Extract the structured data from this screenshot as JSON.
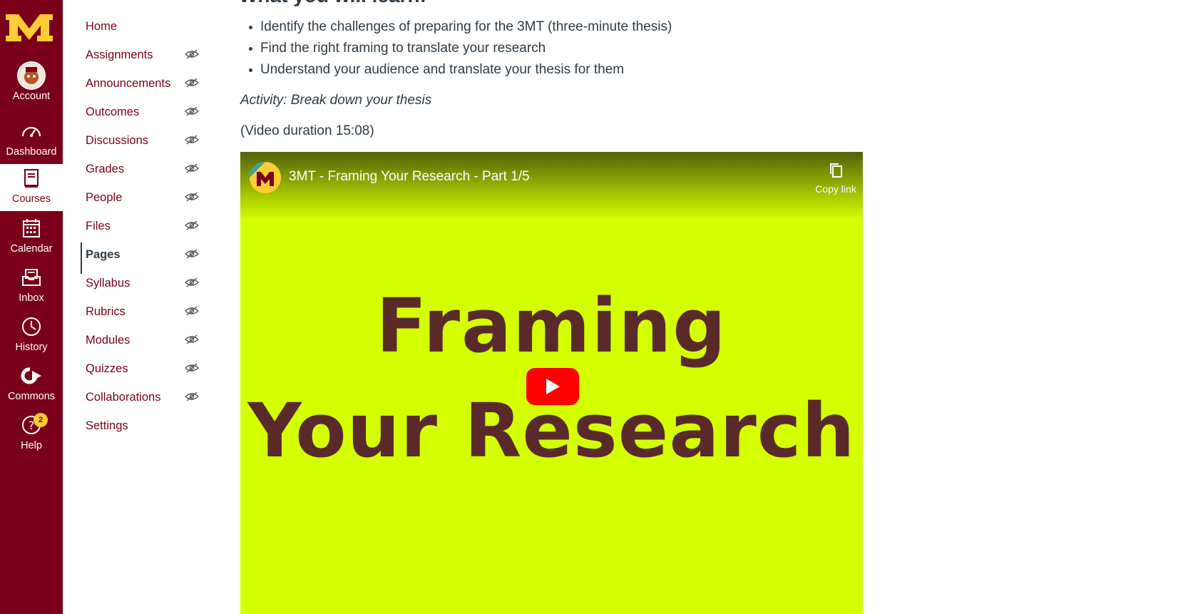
{
  "global_nav": {
    "logo_icon": "university-m-logo",
    "items": [
      {
        "label": "Account",
        "icon": "avatar"
      },
      {
        "label": "Dashboard",
        "icon": "dashboard-icon"
      },
      {
        "label": "Courses",
        "icon": "courses-icon",
        "active": true
      },
      {
        "label": "Calendar",
        "icon": "calendar-icon"
      },
      {
        "label": "Inbox",
        "icon": "inbox-icon"
      },
      {
        "label": "History",
        "icon": "history-icon"
      },
      {
        "label": "Commons",
        "icon": "commons-icon"
      },
      {
        "label": "Help",
        "icon": "help-icon",
        "badge": "2"
      }
    ],
    "colors": {
      "brand": "#7a0019",
      "accent": "#ffcc33"
    }
  },
  "course_nav": {
    "items": [
      {
        "label": "Home",
        "hidden_icon": false
      },
      {
        "label": "Assignments",
        "hidden_icon": true
      },
      {
        "label": "Announcements",
        "hidden_icon": true
      },
      {
        "label": "Outcomes",
        "hidden_icon": true
      },
      {
        "label": "Discussions",
        "hidden_icon": true
      },
      {
        "label": "Grades",
        "hidden_icon": true
      },
      {
        "label": "People",
        "hidden_icon": true
      },
      {
        "label": "Files",
        "hidden_icon": true
      },
      {
        "label": "Pages",
        "hidden_icon": true,
        "active": true
      },
      {
        "label": "Syllabus",
        "hidden_icon": true
      },
      {
        "label": "Rubrics",
        "hidden_icon": true
      },
      {
        "label": "Modules",
        "hidden_icon": true
      },
      {
        "label": "Quizzes",
        "hidden_icon": true
      },
      {
        "label": "Collaborations",
        "hidden_icon": true
      },
      {
        "label": "Settings",
        "hidden_icon": false
      }
    ]
  },
  "content": {
    "heading": "What you will learn:",
    "bullets": [
      "Identify the challenges of preparing for the 3MT (three-minute thesis)",
      "Find the right framing to translate your research",
      "Understand your audience and translate your thesis for them"
    ],
    "activity": "Activity: Break down your thesis",
    "duration": "(Video duration 15:08)",
    "video": {
      "title": "3MT - Framing Your Research - Part 1/5",
      "copy_link_label": "Copy link",
      "thumbnail_line1": "Framing",
      "thumbnail_line2": "Your Research",
      "background_color": "#d4ff00",
      "text_color": "#5a2a2a"
    }
  }
}
